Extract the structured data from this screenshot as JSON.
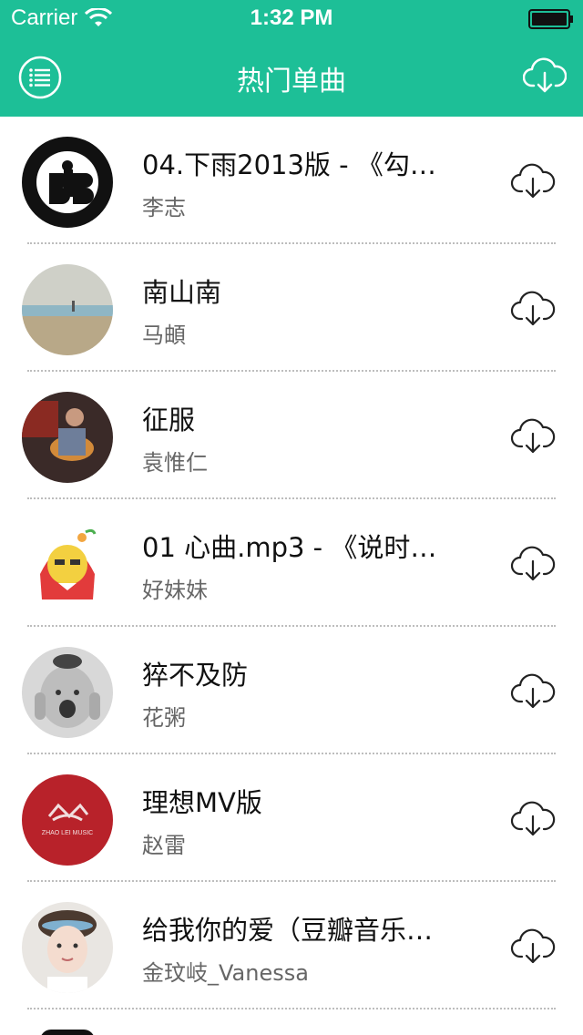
{
  "status_bar": {
    "carrier": "Carrier",
    "time": "1:32 PM"
  },
  "nav": {
    "title": "热门单曲",
    "menu_icon": "menu-icon",
    "download_icon": "cloud-download-icon"
  },
  "songs": [
    {
      "title": "04.下雨2013版 - 《勾…",
      "artist": "李志"
    },
    {
      "title": "南山南",
      "artist": "马頔"
    },
    {
      "title": "征服",
      "artist": "袁惟仁"
    },
    {
      "title": "01 心曲.mp3 - 《说时…",
      "artist": "好妹妹"
    },
    {
      "title": "猝不及防",
      "artist": "花粥"
    },
    {
      "title": "理想MV版",
      "artist": "赵雷"
    },
    {
      "title": "给我你的爱（豆瓣音乐…",
      "artist": "金玟岐_Vanessa"
    }
  ],
  "colors": {
    "accent": "#1dbf97",
    "title": "#111111",
    "artist": "#666666",
    "separator": "#bdbdbd"
  },
  "avatar_text": {
    "zhaolei_logo": "ZHAO LEI MUSIC"
  }
}
